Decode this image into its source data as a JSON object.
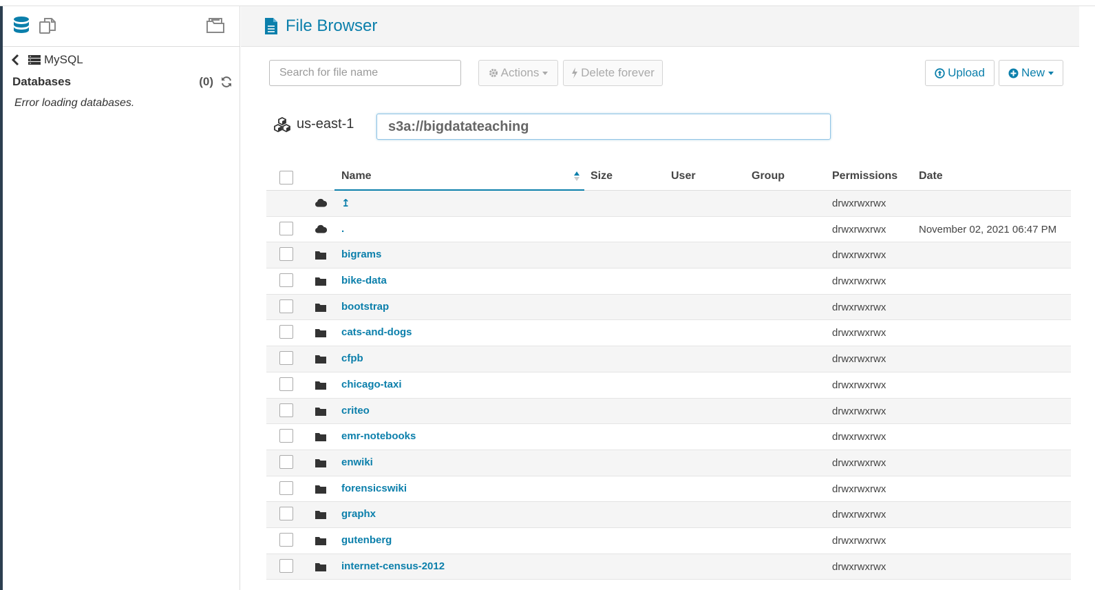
{
  "left_panel": {
    "back_label": "MySQL",
    "databases_label": "Databases",
    "databases_count": "(0)",
    "error_text": "Error loading databases."
  },
  "header": {
    "title": "File Browser"
  },
  "toolbar": {
    "search_placeholder": "Search for file name",
    "actions_label": "Actions",
    "delete_label": "Delete forever",
    "upload_label": "Upload",
    "new_label": "New"
  },
  "location": {
    "region": "us-east-1",
    "path": "s3a://bigdatateaching"
  },
  "table": {
    "columns": [
      "Name",
      "Size",
      "User",
      "Group",
      "Permissions",
      "Date"
    ],
    "rows": [
      {
        "type": "cloud",
        "name": "↥",
        "permissions": "drwxrwxrwx",
        "date": "",
        "checkbox": false
      },
      {
        "type": "cloud",
        "name": ".",
        "permissions": "drwxrwxrwx",
        "date": "November 02, 2021 06:47 PM",
        "checkbox": true
      },
      {
        "type": "folder",
        "name": "bigrams",
        "permissions": "drwxrwxrwx",
        "date": "",
        "checkbox": true
      },
      {
        "type": "folder",
        "name": "bike-data",
        "permissions": "drwxrwxrwx",
        "date": "",
        "checkbox": true
      },
      {
        "type": "folder",
        "name": "bootstrap",
        "permissions": "drwxrwxrwx",
        "date": "",
        "checkbox": true
      },
      {
        "type": "folder",
        "name": "cats-and-dogs",
        "permissions": "drwxrwxrwx",
        "date": "",
        "checkbox": true
      },
      {
        "type": "folder",
        "name": "cfpb",
        "permissions": "drwxrwxrwx",
        "date": "",
        "checkbox": true
      },
      {
        "type": "folder",
        "name": "chicago-taxi",
        "permissions": "drwxrwxrwx",
        "date": "",
        "checkbox": true
      },
      {
        "type": "folder",
        "name": "criteo",
        "permissions": "drwxrwxrwx",
        "date": "",
        "checkbox": true
      },
      {
        "type": "folder",
        "name": "emr-notebooks",
        "permissions": "drwxrwxrwx",
        "date": "",
        "checkbox": true
      },
      {
        "type": "folder",
        "name": "enwiki",
        "permissions": "drwxrwxrwx",
        "date": "",
        "checkbox": true
      },
      {
        "type": "folder",
        "name": "forensicswiki",
        "permissions": "drwxrwxrwx",
        "date": "",
        "checkbox": true
      },
      {
        "type": "folder",
        "name": "graphx",
        "permissions": "drwxrwxrwx",
        "date": "",
        "checkbox": true
      },
      {
        "type": "folder",
        "name": "gutenberg",
        "permissions": "drwxrwxrwx",
        "date": "",
        "checkbox": true
      },
      {
        "type": "folder",
        "name": "internet-census-2012",
        "permissions": "drwxrwxrwx",
        "date": "",
        "checkbox": true
      }
    ]
  },
  "colors": {
    "accent": "#0b7fab",
    "sidebar_edge": "#2c3e50"
  },
  "icons": [
    "database-icon",
    "copy-icon",
    "folder-open-icon",
    "chevron-left-icon",
    "server-icon",
    "refresh-icon",
    "file-icon",
    "gear-icon",
    "bolt-icon",
    "upload-icon",
    "plus-circle-icon",
    "cubes-icon",
    "sort-up-icon",
    "cloud-icon",
    "folder-icon"
  ]
}
